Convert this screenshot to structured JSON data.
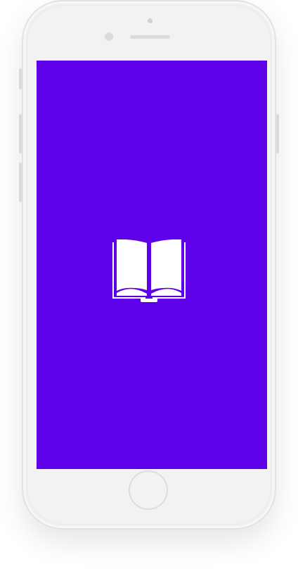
{
  "device": {
    "frame_color": "#f0f0f0",
    "frame_border_color": "#e2e2e2"
  },
  "screen": {
    "background_color": "#5e00e8",
    "icon": {
      "name": "open-book-icon",
      "color": "#ffffff"
    }
  }
}
